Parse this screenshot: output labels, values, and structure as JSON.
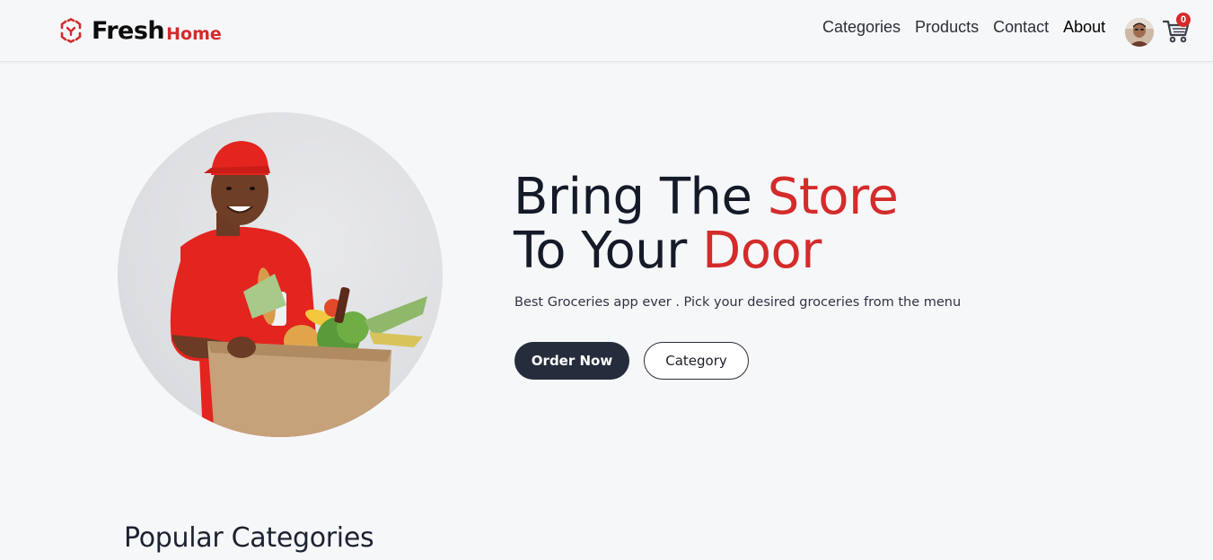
{
  "brand": {
    "name_primary": "Fresh",
    "name_secondary": "Home",
    "logo_icon": "grocery-basket-logo-icon",
    "accent_color": "#d42b2b"
  },
  "nav": {
    "items": [
      {
        "label": "Categories"
      },
      {
        "label": "Products"
      },
      {
        "label": "Contact"
      },
      {
        "label": "About"
      }
    ]
  },
  "header": {
    "avatar_icon": "user-avatar",
    "cart_icon": "cart-icon",
    "cart_count": "0"
  },
  "hero": {
    "headline_line1_prefix": "Bring The ",
    "headline_line1_accent": "Store",
    "headline_line2_prefix": "To Your ",
    "headline_line2_accent": "Door",
    "subtitle": "Best Groceries app ever . Pick your desired groceries from the menu",
    "primary_button": "Order Now",
    "secondary_button": "Category",
    "image": "delivery-man-with-grocery-box"
  },
  "sections": {
    "popular_categories_title": "Popular Categories"
  },
  "colors": {
    "background": "#f6f7f9",
    "dark_button": "#252d3c",
    "text_dark": "#141a28",
    "badge": "#d62a2a"
  }
}
